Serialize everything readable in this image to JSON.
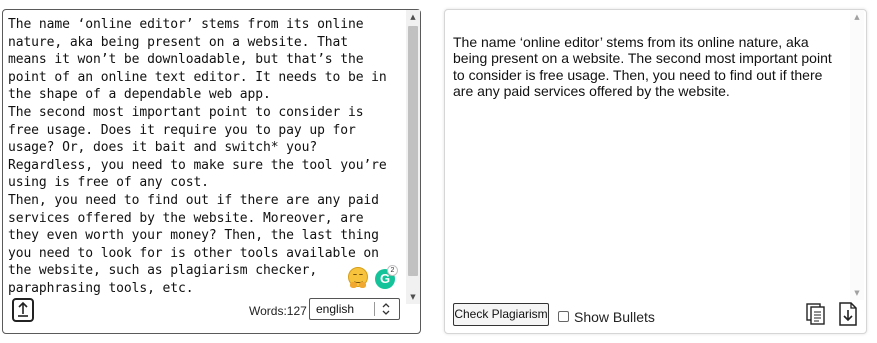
{
  "editor": {
    "lines": [
      "The name ‘online editor’ stems from its online",
      "nature, aka being present on a website. That",
      "means it won’t be downloadable, but that’s the",
      "point of an online text editor. It needs to be in",
      "the shape of a dependable web app.",
      "The second most important point to consider is",
      "free usage. Does it require you to pay up for",
      "usage? Or, does it bait and switch* you?",
      "Regardless, you need to make sure the tool you’re",
      "using is free of any cost.",
      "Then, you need to find out if there are any paid",
      "services offered by the website. Moreover, are",
      "they even worth your money? Then, the last thing",
      "you need to look for is other tools available on",
      "the website, such as plagiarism checker,",
      "paraphrasing tools, etc."
    ],
    "word_count_label": "Words:127",
    "language": "english",
    "grammarly_letter": "G",
    "grammarly_badge": "2",
    "upload_icon": "upload-icon",
    "emoji_icon": "hugging-face-emoji-icon"
  },
  "preview": {
    "text": "The name ‘online editor’ stems from its online nature, aka being present on a website. The second most important point to consider is free usage. Then, you need to find out if there are any paid services offered by the website.",
    "check_button_label": "Check Plagiarism",
    "bullets_label": "Show Bullets",
    "bullets_checked": false,
    "copy_icon": "copy-icon",
    "download_icon": "download-icon"
  },
  "colors": {
    "grammarly": "#15c39a",
    "scrollbar_thumb": "#c1c1c1",
    "left_border": "#5a5a5a"
  }
}
